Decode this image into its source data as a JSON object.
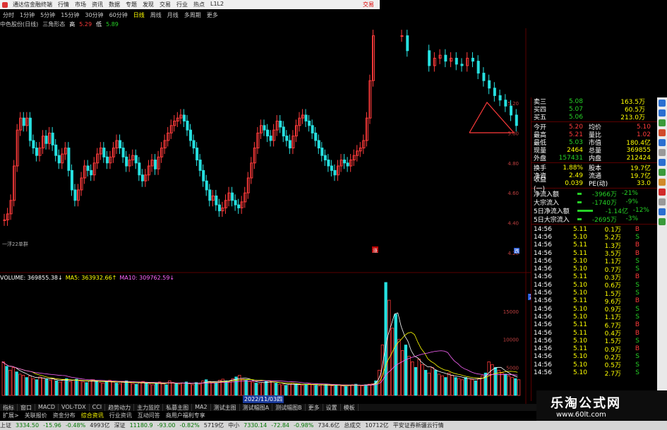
{
  "window": {
    "title": "通达信金融终端",
    "menus": [
      "行情",
      "市场",
      "资讯",
      "数据",
      "专题",
      "发现",
      "交易",
      "行业",
      "热点",
      "L1L2"
    ],
    "right_label": "交易"
  },
  "period_tabs": [
    "分时",
    "1分钟",
    "5分钟",
    "15分钟",
    "30分钟",
    "60分钟",
    "日线",
    "周线",
    "月线",
    "多周期",
    "更多"
  ],
  "period_active": "日线",
  "chart_header": {
    "stock": "中色股份(日线)",
    "indicator": "三角形态",
    "v1_label": "高",
    "v1": "5.29",
    "v2_label": "低",
    "v2": "5.89"
  },
  "chart_data": [
    {
      "type": "candlestick",
      "title": "中色股份(日线)",
      "ylim": [
        4.2,
        5.7
      ],
      "y_ticks": [
        "5.40",
        "5.20",
        "5.00",
        "4.80",
        "4.60",
        "4.40",
        "4.20"
      ],
      "close_series": [
        4.42,
        4.46,
        4.55,
        4.78,
        5.02,
        5.1,
        5.05,
        5.1,
        4.95,
        4.9,
        4.85,
        4.9,
        4.98,
        4.93,
        5.0,
        4.92,
        4.85,
        4.8,
        4.86,
        4.9,
        4.75,
        4.62,
        4.55,
        4.62,
        4.7,
        4.78,
        4.75,
        4.72,
        4.8,
        4.86,
        4.9,
        4.84,
        4.8,
        4.84,
        4.9,
        4.95,
        4.9,
        4.84,
        4.78,
        4.82,
        4.85,
        4.8,
        4.72,
        4.68,
        4.72,
        4.78,
        4.82,
        4.76,
        4.84,
        4.9,
        4.95,
        5.0,
        5.05,
        5.08,
        5.1,
        5.12,
        5.08,
        5.02,
        4.95,
        4.9,
        4.82,
        4.75,
        4.68,
        4.62,
        4.55,
        4.58,
        4.52,
        4.48,
        4.5,
        4.55,
        4.6,
        4.55,
        4.52,
        4.5,
        4.54,
        4.6,
        4.7,
        4.8,
        4.9,
        5.0,
        5.05,
        5.02,
        4.98,
        4.95,
        5.02,
        5.08,
        5.04,
        4.98,
        4.95,
        4.9,
        4.98,
        5.05,
        5.1,
        5.12,
        5.08,
        5.05,
        5.0,
        4.95,
        4.9,
        4.85,
        4.82,
        4.78,
        4.75,
        4.72,
        4.78,
        4.82,
        4.8,
        4.78,
        4.82,
        4.85,
        4.88,
        4.9,
        4.95,
        5.1,
        5.35,
        5.65
      ],
      "right_series": [
        5.65,
        5.55,
        5.5,
        5.52,
        5.48,
        5.45,
        5.5,
        5.52,
        5.48,
        5.5,
        5.46,
        5.45,
        5.5,
        5.48,
        5.4,
        5.35,
        5.3,
        5.25,
        5.22,
        5.18,
        5.12,
        5.05
      ],
      "annotations": [
        "涨",
        "跌",
        "一浮22单群"
      ]
    },
    {
      "type": "bar",
      "title": "VOLUME",
      "ylim": [
        0,
        20163
      ],
      "y_ticks": [
        "20163",
        "15000",
        "10000",
        "5000"
      ],
      "values": [
        6000,
        5200,
        4500,
        5000,
        4200,
        3800,
        3600,
        3200,
        3500,
        3000,
        2800,
        3300,
        3100,
        2900,
        2700,
        3000,
        2600,
        2400,
        2800,
        3000,
        2500,
        2700,
        2900,
        2600,
        2400,
        2300,
        2600,
        2800,
        2500,
        2300,
        2200,
        2500,
        2700,
        2400,
        2200,
        2100,
        2400,
        2600,
        2300,
        2100,
        2000,
        2300,
        2500,
        2200,
        2000,
        1900,
        2200,
        2400,
        2100,
        1900,
        2600,
        2300,
        2100,
        2000,
        2200,
        2400,
        2100,
        1900,
        2300,
        2000,
        2600,
        2800,
        2500,
        2300,
        2200,
        2700,
        2900,
        2600,
        2400,
        3000,
        3300,
        3600,
        2900,
        2700,
        2500,
        2400,
        2200,
        2100,
        2300,
        2500,
        2600,
        2400,
        2200,
        2000,
        1900,
        1800,
        2000,
        2200,
        2000,
        1900,
        1800,
        2000,
        2100,
        1900,
        1800,
        1700,
        1900,
        2000,
        1800,
        1700,
        1800,
        1900,
        1700,
        1600,
        1800,
        1900,
        2000,
        1800,
        1700,
        1900,
        2000,
        2100,
        2600,
        4500,
        9000,
        20163,
        17000,
        12000,
        14500,
        10000,
        8000,
        9000,
        7000,
        6000,
        5000,
        6500,
        5500,
        4500,
        4000,
        5000,
        4500,
        3800,
        3500,
        3200,
        4000,
        3600,
        3200,
        3000,
        2800,
        3200,
        3000,
        2800,
        2600,
        3000,
        3500,
        4000,
        6000,
        5500,
        5000,
        4500,
        4000,
        3800,
        3500,
        3200,
        3000,
        2800
      ]
    }
  ],
  "volume_header": {
    "volume": "VOLUME: 369855.38↓",
    "ma5": "MA5: 363932.66↑",
    "ma10": "MA10: 309762.59↓"
  },
  "volume_cursor": "20163",
  "date_cursor": "2022/11/03四",
  "quote": {
    "asks": [
      {
        "label": "卖三",
        "price": "5.08",
        "vol": "163.5万"
      },
      {
        "label": "买四",
        "price": "5.07",
        "vol": "60.5万"
      },
      {
        "label": "买五",
        "price": "5.06",
        "vol": "213.0万"
      }
    ],
    "stats": [
      {
        "l1": "今开",
        "v1": "5.20",
        "l2": "均价",
        "v2": "5.10"
      },
      {
        "l1": "最高",
        "v1": "5.21",
        "l2": "量比",
        "v2": "1.02"
      },
      {
        "l1": "最低",
        "v1": "5.03",
        "l2": "市值",
        "v2": "180.4亿"
      },
      {
        "l1": "现量",
        "v1": "2464",
        "l2": "总量",
        "v2": "369855"
      },
      {
        "l1": "外盘",
        "v1": "157431",
        "l2": "内盘",
        "v2": "212424"
      },
      {
        "l1": "换手",
        "v1": "1.88%",
        "l2": "股本",
        "v2": "19.7亿"
      },
      {
        "l1": "净资",
        "v1": "2.49",
        "l2": "流通",
        "v2": "19.7亿"
      },
      {
        "l1": "收益(一)",
        "v1": "0.039",
        "l2": "PE(动)",
        "v2": "33.0"
      }
    ],
    "flows": [
      {
        "label": "净流入额",
        "value": "-3966万",
        "pct": "-21%"
      },
      {
        "label": "大宗流入",
        "value": "-1740万",
        "pct": "-9%"
      },
      {
        "label": "5日净流入额",
        "value": "-1.14亿",
        "pct": "-12%"
      },
      {
        "label": "5日大宗流入",
        "value": "-2695万",
        "pct": "-3%"
      }
    ],
    "ticks": [
      {
        "time": "14:56",
        "price": "5.11",
        "vol": "0.1万",
        "bs": "B"
      },
      {
        "time": "14:56",
        "price": "5.10",
        "vol": "5.2万",
        "bs": "S"
      },
      {
        "time": "14:56",
        "price": "5.11",
        "vol": "1.3万",
        "bs": "B"
      },
      {
        "time": "14:56",
        "price": "5.11",
        "vol": "3.5万",
        "bs": "B"
      },
      {
        "time": "14:56",
        "price": "5.10",
        "vol": "1.1万",
        "bs": "S"
      },
      {
        "time": "14:56",
        "price": "5.10",
        "vol": "0.7万",
        "bs": "S"
      },
      {
        "time": "14:56",
        "price": "5.11",
        "vol": "0.3万",
        "bs": "B"
      },
      {
        "time": "14:56",
        "price": "5.10",
        "vol": "0.6万",
        "bs": "S"
      },
      {
        "time": "14:56",
        "price": "5.10",
        "vol": "1.5万",
        "bs": "S"
      },
      {
        "time": "14:56",
        "price": "5.11",
        "vol": "9.6万",
        "bs": "B"
      },
      {
        "time": "14:56",
        "price": "5.10",
        "vol": "0.9万",
        "bs": "S"
      },
      {
        "time": "14:56",
        "price": "5.10",
        "vol": "1.1万",
        "bs": "S"
      },
      {
        "time": "14:56",
        "price": "5.11",
        "vol": "6.7万",
        "bs": "B"
      },
      {
        "time": "14:56",
        "price": "5.11",
        "vol": "0.4万",
        "bs": "B"
      },
      {
        "time": "14:56",
        "price": "5.10",
        "vol": "1.5万",
        "bs": "S"
      },
      {
        "time": "14:56",
        "price": "5.11",
        "vol": "0.9万",
        "bs": "B"
      },
      {
        "time": "14:56",
        "price": "5.10",
        "vol": "0.2万",
        "bs": "S"
      },
      {
        "time": "14:56",
        "price": "5.10",
        "vol": "0.5万",
        "bs": "S"
      },
      {
        "time": "14:56",
        "price": "5.10",
        "vol": "2.7万",
        "bs": "S"
      }
    ]
  },
  "bottom_tabs": [
    "指标",
    "窗口",
    "MACD",
    "VOL-TDX",
    "CCI",
    "趋势动力",
    "主力监控",
    "私募主图",
    "MA2",
    "测试主图",
    "测试幅图A",
    "测试幅图B",
    "更多",
    "设置",
    "模板"
  ],
  "bottom_tabs2": [
    "扩展>",
    "关联报价",
    "资金分布",
    "综合资讯",
    "行业资讯",
    "互动问答",
    "商用户福利专享"
  ],
  "bottom_active": "综合资讯",
  "statusbar": {
    "items": [
      {
        "text": "上证",
        "cls": ""
      },
      {
        "text": "3334.50",
        "cls": "g"
      },
      {
        "text": "-15.96",
        "cls": "g"
      },
      {
        "text": "-0.48%",
        "cls": "g"
      },
      {
        "text": "4993亿",
        "cls": ""
      },
      {
        "text": "深证",
        "cls": ""
      },
      {
        "text": "11180.9",
        "cls": "g"
      },
      {
        "text": "-93.00",
        "cls": "g"
      },
      {
        "text": "-0.82%",
        "cls": "g"
      },
      {
        "text": "5719亿",
        "cls": ""
      },
      {
        "text": "中小",
        "cls": ""
      },
      {
        "text": "7330.14",
        "cls": "g"
      },
      {
        "text": "-72.84",
        "cls": "g"
      },
      {
        "text": "-0.98%",
        "cls": "g"
      },
      {
        "text": "734.6亿",
        "cls": ""
      },
      {
        "text": "总成交",
        "cls": ""
      },
      {
        "text": "10712亿",
        "cls": ""
      },
      {
        "text": "平安证券新疆云行情",
        "cls": ""
      }
    ]
  },
  "brand": {
    "title": "乐淘公式网",
    "url": "www.60lt.com"
  },
  "toolbar_icons": [
    "zoom-in-icon",
    "zoom-out-icon",
    "refresh-icon",
    "settings-icon",
    "chart-icon",
    "search-icon",
    "list-icon",
    "info-icon",
    "arrow-icon",
    "flag-icon",
    "lock-icon",
    "grid-icon",
    "help-icon"
  ],
  "colors": {
    "up": "#ff3b3b",
    "down": "#26e0e0",
    "panel_border": "#5a0000"
  }
}
